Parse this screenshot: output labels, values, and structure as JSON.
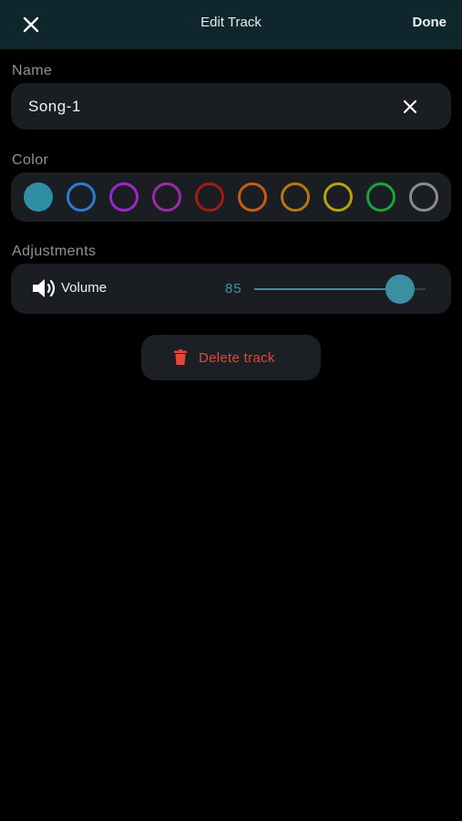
{
  "header": {
    "title": "Edit Track",
    "done_label": "Done"
  },
  "name_section": {
    "label": "Name",
    "value": "Song-1"
  },
  "color_section": {
    "label": "Color",
    "selected_index": 0,
    "swatches": [
      "#2f8ea3",
      "#2a7bd6",
      "#9b27c9",
      "#9c2aa8",
      "#a01b1b",
      "#c65a17",
      "#b9760f",
      "#b5a40f",
      "#1ea13a",
      "#8c8c8c"
    ]
  },
  "adjustments_section": {
    "label": "Adjustments",
    "volume": {
      "label": "Volume",
      "value": "85",
      "level": 0.85
    }
  },
  "actions": {
    "delete_label": "Delete track"
  },
  "icons": {
    "close": "close-icon",
    "clear": "clear-icon",
    "speaker": "speaker-icon",
    "trash": "trash-icon"
  }
}
